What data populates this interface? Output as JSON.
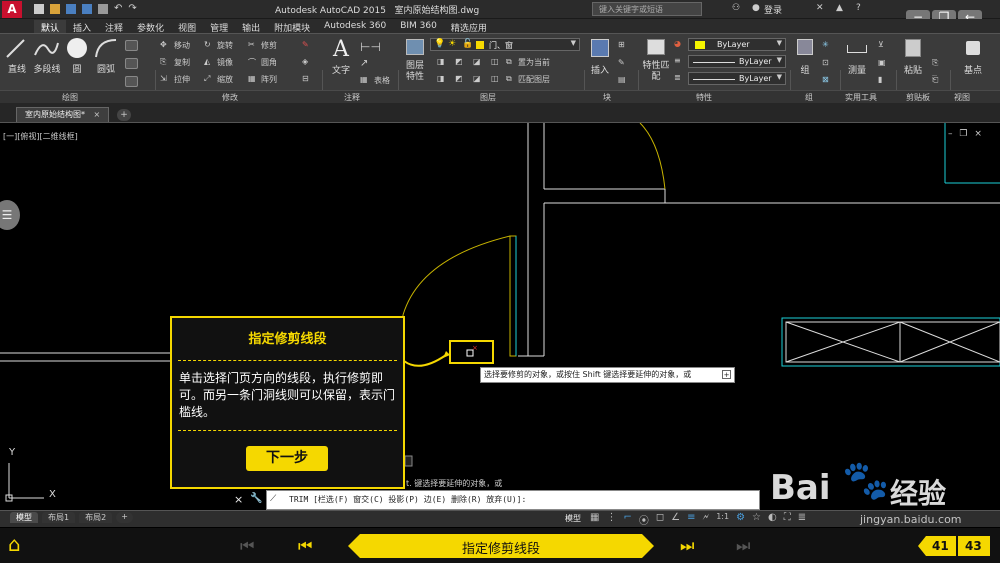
{
  "app": {
    "title": "Autodesk AutoCAD 2015",
    "filename": "室内原始结构图.dwg",
    "search_placeholder": "键入关键字或短语",
    "login": "登录"
  },
  "menu_tabs": [
    "默认",
    "插入",
    "注释",
    "参数化",
    "视图",
    "管理",
    "输出",
    "附加模块",
    "Autodesk 360",
    "BIM 360",
    "精选应用"
  ],
  "ribbon": {
    "draw": {
      "line": "直线",
      "polyline": "多段线",
      "circle": "圆",
      "arc": "圆弧",
      "group": "绘图"
    },
    "modify": {
      "move": "移动",
      "rotate": "旋转",
      "trim": "修剪",
      "copy": "复制",
      "mirror": "镜像",
      "fillet": "圆角",
      "stretch": "拉伸",
      "scale": "缩放",
      "array": "阵列",
      "group": "修改"
    },
    "annotation": {
      "text": "文字",
      "table": "表格",
      "group": "注释"
    },
    "layers": {
      "layer_props": "图层特性",
      "current_layer": "门、窗",
      "set_current": "置为当前",
      "match_layer": "匹配图层",
      "group": "图层"
    },
    "block": {
      "insert": "插入",
      "group": "块"
    },
    "properties": {
      "match_props": "特性匹配",
      "color": "ByLayer",
      "linetype": "ByLayer",
      "lineweight": "ByLayer",
      "group": "特性"
    },
    "groups": {
      "group": "组"
    },
    "utilities": {
      "measure": "测量",
      "group": "实用工具"
    },
    "clipboard": {
      "paste": "粘贴",
      "group": "剪贴板"
    },
    "view": {
      "base": "基点",
      "group": "视图"
    }
  },
  "doc_tab": "室内原始结构图*",
  "viewport_label": "[一][俯视][二维线框]",
  "tooltip": {
    "title": "指定修剪线段",
    "body": "单击选择门页方向的线段，执行修剪即可。而另一条门洞线则可以保留，表示门槛线。",
    "next_button": "下一步"
  },
  "prompt_text": "选择要修剪的对象，或按住 Shift 键选择要延伸的对象，或",
  "prompt_behind": "t. 键选择要延伸的对象，或",
  "command_line": "TRIM [栏选(F) 窗交(C) 投影(P) 边(E) 删除(R) 放弃(U)]:",
  "layout_tabs": [
    "模型",
    "布局1",
    "布局2"
  ],
  "status_model": "模型",
  "status_scale": "1:1",
  "axis": {
    "x": "X",
    "y": "Y"
  },
  "bottom_nav": {
    "center_title": "指定修剪线段",
    "current": "41",
    "total": "43"
  },
  "watermark": {
    "text": "Bai",
    "cn": "经验",
    "url": "jingyan.baidu.com"
  },
  "colors": {
    "accent_yellow": "#f5d800",
    "door_yellow": "#c8b400",
    "cyan": "#1bd0d8"
  }
}
